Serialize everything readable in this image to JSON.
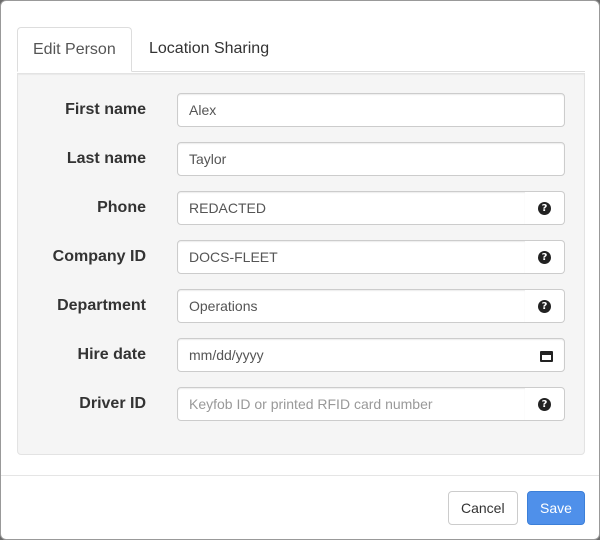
{
  "tabs": [
    {
      "label": "Edit Person",
      "active": true
    },
    {
      "label": "Location Sharing",
      "active": false
    }
  ],
  "form": {
    "first_name": {
      "label": "First name",
      "value": "Alex"
    },
    "last_name": {
      "label": "Last name",
      "value": "Taylor"
    },
    "phone": {
      "label": "Phone",
      "value": "REDACTED"
    },
    "company_id": {
      "label": "Company ID",
      "value": "DOCS-FLEET"
    },
    "department": {
      "label": "Department",
      "value": "Operations"
    },
    "hire_date": {
      "label": "Hire date",
      "value": "mm/dd/yyyy"
    },
    "driver_id": {
      "label": "Driver ID",
      "value": "",
      "placeholder": "Keyfob ID or printed RFID card number"
    }
  },
  "footer": {
    "cancel_label": "Cancel",
    "save_label": "Save"
  },
  "icons": {
    "help": "question-circle-icon",
    "calendar": "calendar-icon"
  },
  "colors": {
    "primary": "#4f90ea",
    "panel_bg": "#f5f5f5"
  }
}
